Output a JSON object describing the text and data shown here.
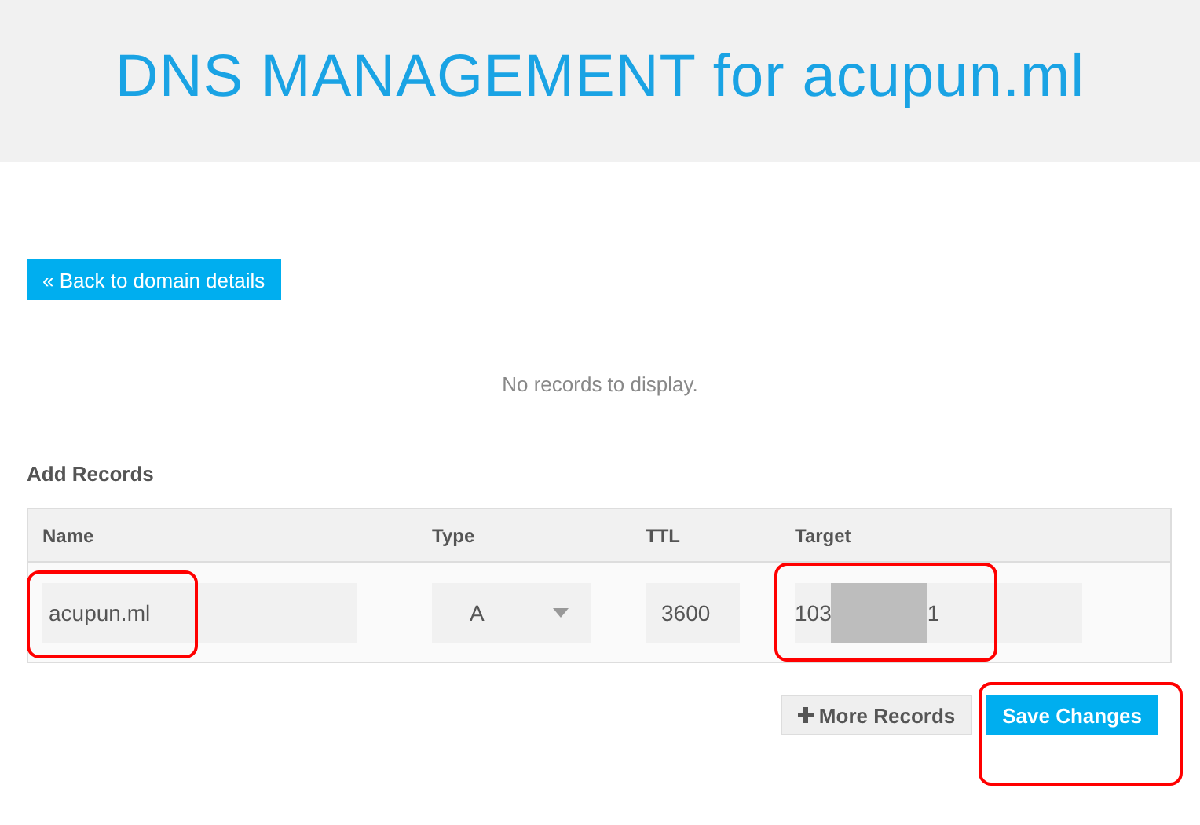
{
  "header": {
    "title": "DNS MANAGEMENT for acupun.ml"
  },
  "back_button": {
    "label": "« Back to domain details"
  },
  "empty_message": "No records to display.",
  "add_records": {
    "title": "Add Records",
    "columns": [
      "Name",
      "Type",
      "TTL",
      "Target"
    ],
    "row": {
      "name": {
        "value": "acupun.ml",
        "highlighted": true
      },
      "type": {
        "value": "A"
      },
      "ttl": {
        "value": "3600"
      },
      "target": {
        "value_parts": [
          "103",
          "1"
        ],
        "redacted": true,
        "highlighted": true
      }
    }
  },
  "buttons": [
    {
      "kind": "secondary",
      "label": "More Records"
    },
    {
      "kind": "primary",
      "label": "Save Changes",
      "highlighted": true
    }
  ]
}
